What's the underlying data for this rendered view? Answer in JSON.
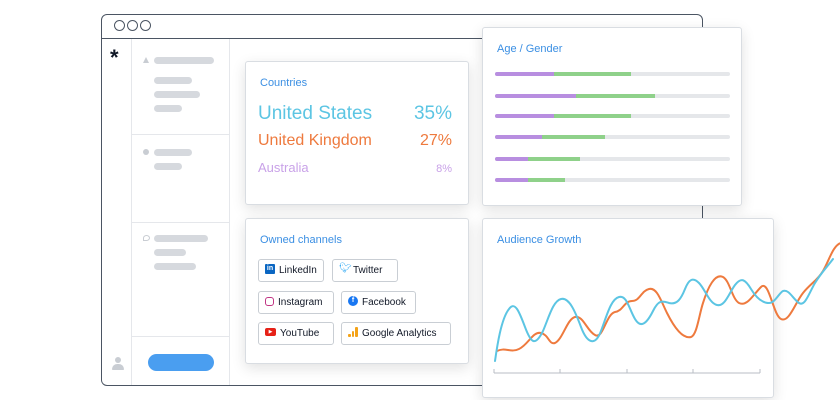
{
  "countries_card": {
    "title": "Countries",
    "rows": [
      {
        "name": "United States",
        "pct": "35%",
        "color": "#5cc5e3"
      },
      {
        "name": "United Kingdom",
        "pct": "27%",
        "color": "#ee7a3e"
      },
      {
        "name": "Australia",
        "pct": "8%",
        "color": "#c9a2e8"
      }
    ]
  },
  "age_gender_card": {
    "title": "Age / Gender",
    "bars": [
      {
        "female": 0.25,
        "male": 0.33
      },
      {
        "female": 0.345,
        "male": 0.335
      },
      {
        "female": 0.25,
        "male": 0.33
      },
      {
        "female": 0.2,
        "male": 0.27
      },
      {
        "female": 0.14,
        "male": 0.22
      },
      {
        "female": 0.14,
        "male": 0.16
      }
    ],
    "colors": {
      "female": "#b88ee0",
      "male": "#8fd18a",
      "track": "#e5e7ea"
    }
  },
  "owned_channels_card": {
    "title": "Owned channels",
    "channels": [
      {
        "label": "LinkedIn",
        "icon": "linkedin-icon"
      },
      {
        "label": "Twitter",
        "icon": "twitter-icon"
      },
      {
        "label": "Instagram",
        "icon": "instagram-icon"
      },
      {
        "label": "Facebook",
        "icon": "facebook-icon"
      },
      {
        "label": "YouTube",
        "icon": "youtube-icon"
      },
      {
        "label": "Google Analytics",
        "icon": "google-analytics-icon"
      }
    ]
  },
  "audience_growth_card": {
    "title": "Audience Growth",
    "series_colors": [
      "#ee7a3e",
      "#5cc5e3"
    ]
  },
  "sidebar": {
    "logo_glyph": "*",
    "cta_color": "#4a9ef0"
  },
  "accent_color": "#3b8fe3"
}
